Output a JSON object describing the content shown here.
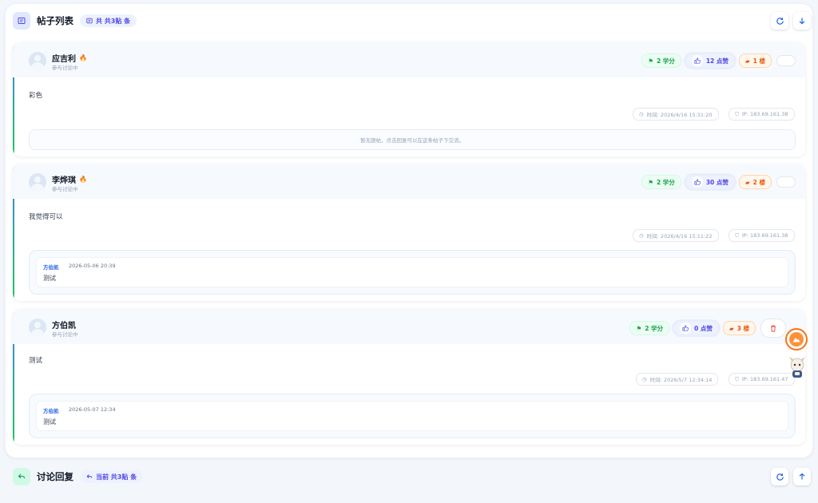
{
  "posts_section": {
    "title": "帖子列表",
    "count_label": "共 共3贴 条"
  },
  "posts": [
    {
      "author": "应吉利",
      "status": "参与讨论中",
      "score": "2 学分",
      "likes": "12 点赞",
      "floor": "1 楼",
      "content": "彩色",
      "time": "时间: 2026/4/16 15:31:20",
      "ip": "IP: 183.69.161.38",
      "empty_reply_text": "暂无跟帖，点击回复可以在这条帖子下交流。"
    },
    {
      "author": "李烨琪",
      "status": "参与讨论中",
      "score": "2 学分",
      "likes": "30 点赞",
      "floor": "2 楼",
      "content": "我觉得可以",
      "time": "时间: 2026/4/16 15:11:22",
      "ip": "IP: 183.69.161.38",
      "reply": {
        "user": "方伯凯",
        "time": "2026-05-06 20:39",
        "text": "测试"
      }
    },
    {
      "author": "方伯凯",
      "status": "参与讨论中",
      "score": "2 学分",
      "likes": "0 点赞",
      "floor": "3 楼",
      "content": "测试",
      "time": "时间: 2026/5/7 12:34:14",
      "ip": "IP: 183.69.161.47",
      "reply": {
        "user": "方伯凯",
        "time": "2026-05-07 12:34",
        "text": "测试"
      }
    }
  ],
  "reply_section": {
    "title": "讨论回复",
    "count_label": "当前 共3贴 条"
  },
  "colors": {
    "accent": "#4f46e5",
    "score": "#16a34a",
    "floor": "#ea580c",
    "delete": "#ef4444"
  },
  "icons": {
    "posts_section": "list-icon",
    "reply_section": "reply-arrow-icon",
    "refresh": "refresh-icon",
    "down": "arrow-down-icon",
    "up": "arrow-up-icon",
    "like": "thumbs-up-icon",
    "score": "flag-icon",
    "floor": "layers-icon",
    "time": "clock-icon",
    "ip": "shield-icon",
    "delete": "trash-icon"
  }
}
